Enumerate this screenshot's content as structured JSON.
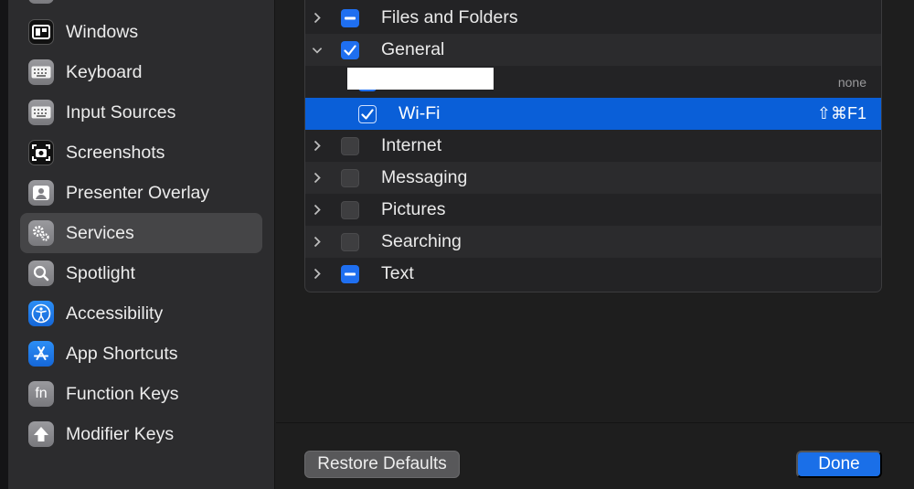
{
  "sidebar": {
    "items": [
      {
        "label": "Windows",
        "icon": "windows-icon",
        "selected": false
      },
      {
        "label": "Keyboard",
        "icon": "keyboard-icon",
        "selected": false
      },
      {
        "label": "Input Sources",
        "icon": "input-sources-icon",
        "selected": false
      },
      {
        "label": "Screenshots",
        "icon": "camera-icon",
        "selected": false
      },
      {
        "label": "Presenter Overlay",
        "icon": "person-icon",
        "selected": false
      },
      {
        "label": "Services",
        "icon": "gears-icon",
        "selected": true
      },
      {
        "label": "Spotlight",
        "icon": "magnifier-icon",
        "selected": false
      },
      {
        "label": "Accessibility",
        "icon": "accessibility-icon",
        "selected": false
      },
      {
        "label": "App Shortcuts",
        "icon": "app-store-icon",
        "selected": false
      },
      {
        "label": "Function Keys",
        "icon": "fn-icon",
        "selected": false
      },
      {
        "label": "Modifier Keys",
        "icon": "up-arrow-icon",
        "selected": false
      }
    ],
    "fn_glyph": "fn"
  },
  "services": {
    "rows": [
      {
        "label": "Files and Folders",
        "state": "mixed",
        "expanded": false
      },
      {
        "label": "General",
        "state": "checked",
        "expanded": true
      },
      {
        "label": "",
        "state": "checked",
        "child": true,
        "redacted": true,
        "shortcut": "none"
      },
      {
        "label": "Wi-Fi",
        "state": "checked",
        "child": true,
        "selected": true,
        "shortcut": "⇧⌘F1"
      },
      {
        "label": "Internet",
        "state": "unchecked",
        "expanded": false
      },
      {
        "label": "Messaging",
        "state": "unchecked",
        "expanded": false
      },
      {
        "label": "Pictures",
        "state": "unchecked",
        "expanded": false
      },
      {
        "label": "Searching",
        "state": "unchecked",
        "expanded": false
      },
      {
        "label": "Text",
        "state": "mixed",
        "expanded": false
      }
    ]
  },
  "buttons": {
    "restore_defaults": "Restore Defaults",
    "done": "Done"
  },
  "colors": {
    "accent": "#0a5fd8",
    "sidebar_bg": "#2c2c2e",
    "main_bg": "#1e1e1e",
    "selected_sidebar": "#454547"
  }
}
